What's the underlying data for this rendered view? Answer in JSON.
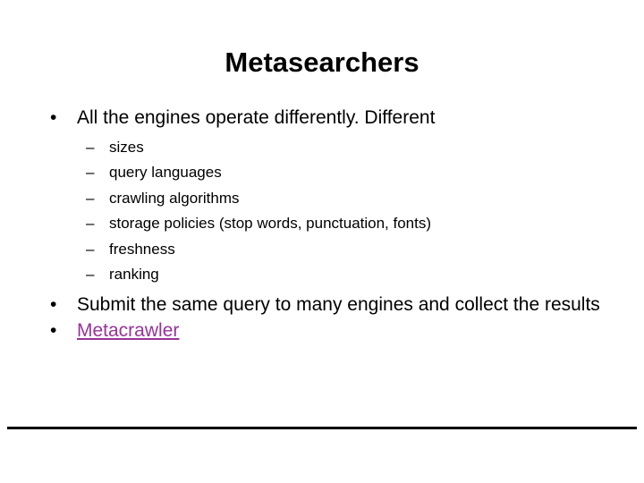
{
  "slide": {
    "title": "Metasearchers",
    "bullet_marker": "•",
    "dash_marker": "–",
    "link_color": "#993399",
    "text_color": "#000000",
    "background_color": "#ffffff",
    "rule_color": "#000000",
    "bullets": [
      {
        "level": 1,
        "text": "All the engines operate differently.  Different",
        "is_link": false
      },
      {
        "level": 2,
        "text": "sizes",
        "is_link": false
      },
      {
        "level": 2,
        "text": "query languages",
        "is_link": false
      },
      {
        "level": 2,
        "text": "crawling algorithms",
        "is_link": false
      },
      {
        "level": 2,
        "text": "storage policies (stop words, punctuation, fonts)",
        "is_link": false
      },
      {
        "level": 2,
        "text": "freshness",
        "is_link": false
      },
      {
        "level": 2,
        "text": "ranking",
        "is_link": false
      },
      {
        "level": 1,
        "text": "Submit the same query to many engines and collect the results",
        "is_link": false
      },
      {
        "level": 1,
        "text": "Metacrawler",
        "is_link": true
      }
    ]
  }
}
